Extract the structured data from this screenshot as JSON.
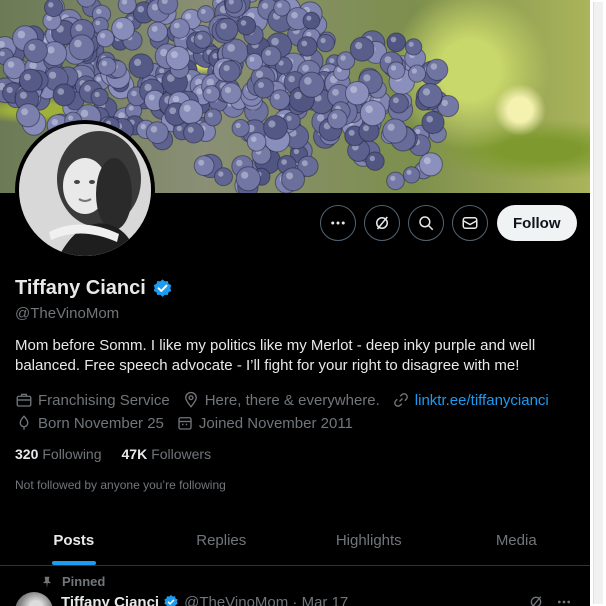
{
  "profile": {
    "display_name": "Tiffany Cianci",
    "handle": "@TheVinoMom",
    "bio": "Mom before Somm. I like my politics like my Merlot - deep inky purple and well balanced. Free speech advocate - I’ll fight for your right to disagree with me!",
    "category": "Franchising Service",
    "location": "Here, there & everywhere.",
    "website": "linktr.ee/tiffanycianci",
    "birthday": "Born November 25",
    "joined": "Joined November 2011",
    "following_count": "320",
    "following_label": "Following",
    "followers_count": "47K",
    "followers_label": "Followers",
    "followed_note": "Not followed by anyone you’re following"
  },
  "actions": {
    "follow_label": "Follow"
  },
  "tabs": [
    {
      "label": "Posts",
      "active": true
    },
    {
      "label": "Replies",
      "active": false
    },
    {
      "label": "Highlights",
      "active": false
    },
    {
      "label": "Media",
      "active": false
    }
  ],
  "pinned_post": {
    "label": "Pinned",
    "author": "Tiffany Cianci",
    "meta": "@TheVinoMom · Mar 17"
  },
  "colors": {
    "accent": "#1d9bf0",
    "background": "#000000",
    "muted": "#71767b"
  },
  "icons": [
    "more-icon",
    "subscribe-icon",
    "search-icon",
    "message-icon",
    "verified-icon",
    "briefcase-icon",
    "location-icon",
    "link-icon",
    "birthday-icon",
    "calendar-icon",
    "pin-icon"
  ]
}
